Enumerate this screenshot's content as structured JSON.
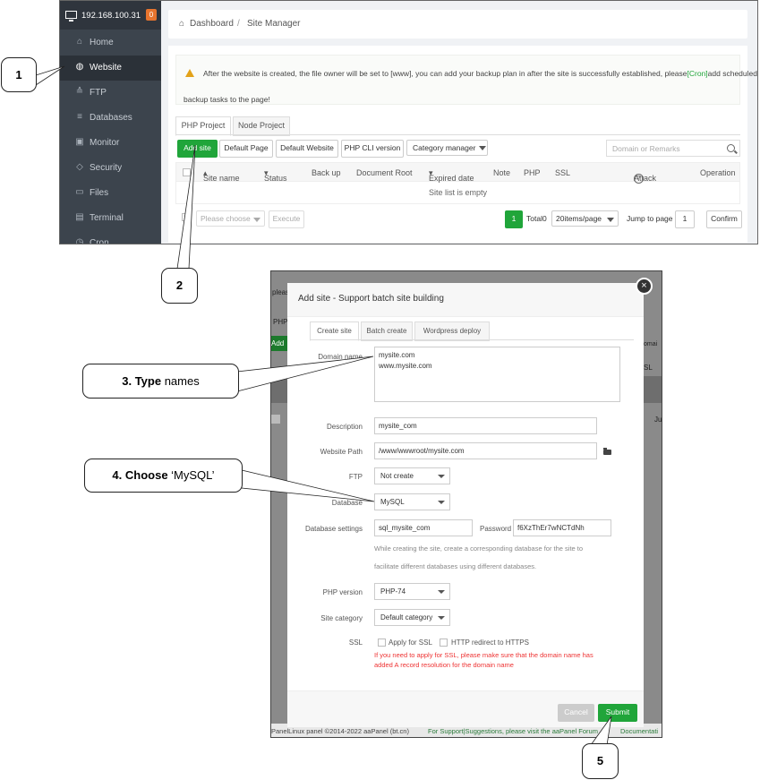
{
  "top": {
    "ip": "192.168.100.31",
    "badge": "0",
    "sidebar": [
      {
        "label": "Home",
        "icon": "home-icon"
      },
      {
        "label": "Website",
        "icon": "globe-icon",
        "active": true
      },
      {
        "label": "FTP",
        "icon": "ftp-icon"
      },
      {
        "label": "Databases",
        "icon": "database-icon"
      },
      {
        "label": "Monitor",
        "icon": "monitor-icon"
      },
      {
        "label": "Security",
        "icon": "shield-icon"
      },
      {
        "label": "Files",
        "icon": "folder-icon"
      },
      {
        "label": "Terminal",
        "icon": "terminal-icon"
      },
      {
        "label": "Cron",
        "icon": "clock-icon"
      }
    ],
    "breadcrumb": {
      "home": "Dashboard",
      "sep": "/",
      "current": "Site Manager"
    },
    "notice": {
      "before": "After the website is created, the file owner will be set to [www], you can add your backup plan in after the site is successfully established, please",
      "link": "[Cron]",
      "after": "add scheduled",
      "line2": "backup tasks to the page!"
    },
    "tabs": [
      "PHP Project",
      "Node Project"
    ],
    "toolbar": {
      "add_site": "Add site",
      "default_page": "Default Page",
      "default_website": "Default Website",
      "php_cli": "PHP CLI version",
      "category": "Category manager",
      "search_placeholder": "Domain or Remarks"
    },
    "columns": [
      "Site name",
      "Status",
      "Back up",
      "Document Root",
      "Expired date",
      "Note",
      "PHP",
      "SSL",
      "Attack",
      "Operation"
    ],
    "empty": "Site list is empty",
    "bottom": {
      "please_choose": "Please choose",
      "execute": "Execute",
      "page": "1",
      "total": "Total0",
      "per_page": "20items/page",
      "jump": "Jump to page",
      "jump_value": "1",
      "confirm": "Confirm"
    }
  },
  "modal": {
    "title": "Add site - Support batch site building",
    "tabs": [
      "Create site",
      "Batch create",
      "Wordpress deploy"
    ],
    "domain_label": "Domain name",
    "domain_lines": [
      "mysite.com",
      "www.mysite.com"
    ],
    "description_label": "Description",
    "description": "mysite_com",
    "path_label": "Website Path",
    "path": "/www/wwwroot/mysite.com",
    "ftp_label": "FTP",
    "ftp": "Not create",
    "database_label": "Database",
    "database": "MySQL",
    "dbsettings_label": "Database settings",
    "db_name": "sql_mysite_com",
    "password_label": "Password",
    "password": "f6XzThEr7wNCTdNh",
    "hint1": "While creating the site, create a corresponding database for the site to",
    "hint2": "facilitate different databases using different databases.",
    "php_label": "PHP version",
    "php": "PHP-74",
    "category_label": "Site category",
    "category": "Default category",
    "ssl_label": "SSL",
    "ssl_apply": "Apply for SSL",
    "ssl_redirect": "HTTP redirect to HTTPS",
    "warn1": "If you need to apply for SSL, please make sure that the domain name has",
    "warn2": "added A record resolution for the domain name",
    "cancel": "Cancel",
    "submit": "Submit",
    "footer_left": "PanelLinux panel ©2014-2022 aaPanel (bt.cn)",
    "footer_mid": "For Support|Suggestions, please visit the aaPanel Forum",
    "footer_right": "Documentati",
    "bg_fragments": [
      "pleas",
      "PHP",
      "Add",
      "omai",
      "SL",
      "Ju"
    ]
  },
  "callouts": {
    "c1": "1",
    "c2": "2",
    "c3_bold": "3. Type",
    "c3_rest": " names",
    "c4_bold": "4. Choose",
    "c4_rest": " ‘MySQL’",
    "c5": "5"
  },
  "colors": {
    "accent": "#20a53a",
    "sidebar": "#3c444d",
    "warning": "#e33"
  }
}
